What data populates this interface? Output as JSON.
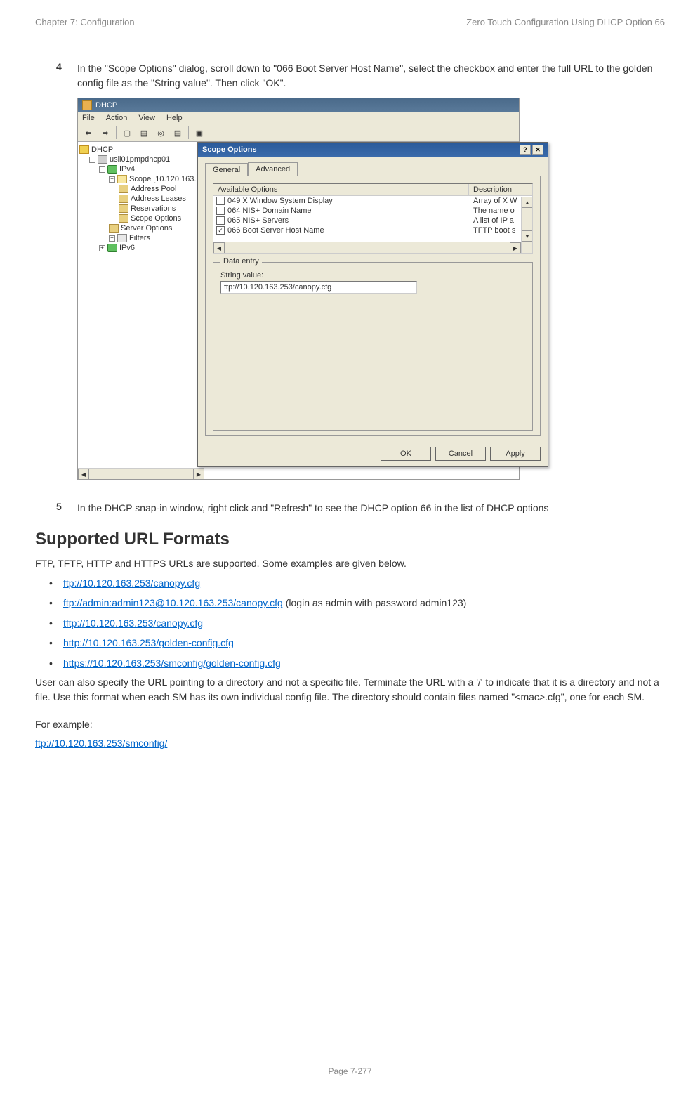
{
  "header": {
    "left": "Chapter 7:  Configuration",
    "right": "Zero Touch Configuration Using DHCP Option 66"
  },
  "step4": {
    "num": "4",
    "text": "In the \"Scope Options\" dialog, scroll down to \"066 Boot Server Host Name\", select the checkbox and enter the full URL to the golden config file as the \"String value\". Then click \"OK\"."
  },
  "screenshot": {
    "app_title": "DHCP",
    "menus": {
      "file": "File",
      "action": "Action",
      "view": "View",
      "help": "Help"
    },
    "tree": {
      "root": "DHCP",
      "server": "usil01pmpdhcp01",
      "ipv4": "IPv4",
      "scope": "Scope [10.120.163.",
      "address_pool": "Address Pool",
      "address_leases": "Address Leases",
      "reservations": "Reservations",
      "scope_options": "Scope Options",
      "server_options": "Server Options",
      "filters": "Filters",
      "ipv6": "IPv6"
    },
    "dialog": {
      "title": "Scope Options",
      "tab_general": "General",
      "tab_advanced": "Advanced",
      "col_available": "Available Options",
      "col_description": "Description",
      "options": [
        {
          "checked": false,
          "name": "049 X Window System Display",
          "desc": "Array of X W"
        },
        {
          "checked": false,
          "name": "064 NIS+ Domain Name",
          "desc": "The name o"
        },
        {
          "checked": false,
          "name": "065 NIS+ Servers",
          "desc": "A list of IP a"
        },
        {
          "checked": true,
          "name": "066 Boot Server Host Name",
          "desc": "TFTP boot s"
        }
      ],
      "data_entry_legend": "Data entry",
      "string_value_label": "String value:",
      "string_value": "ftp://10.120.163.253/canopy.cfg",
      "btn_ok": "OK",
      "btn_cancel": "Cancel",
      "btn_apply": "Apply"
    }
  },
  "step5": {
    "num": "5",
    "text": "In the DHCP snap-in window, right click and \"Refresh\" to see the DHCP option 66 in the list of DHCP options"
  },
  "section_heading": "Supported URL Formats",
  "intro": "FTP, TFTP, HTTP and HTTPS URLs are supported. Some examples are given below.",
  "urls": {
    "u1": "ftp://10.120.163.253/canopy.cfg",
    "u2": "ftp://admin:admin123@10.120.163.253/canopy.cfg",
    "u2_suffix": "  (login as admin with password admin123)",
    "u3": "tftp://10.120.163.253/canopy.cfg",
    "u4": "http://10.120.163.253/golden-config.cfg",
    "u5": "https://10.120.163.253/smconfig/golden-config.cfg"
  },
  "para1": "User can also specify the URL pointing to a directory and not a specific file. Terminate the URL with a '/' to indicate that it is a directory and not a file. Use this format when each SM has its own individual config file. The directory should contain files named \"<mac>.cfg\", one for each SM.",
  "example_label": "For example:",
  "example_url": "ftp://10.120.163.253/smconfig/",
  "footer": "Page 7-277"
}
